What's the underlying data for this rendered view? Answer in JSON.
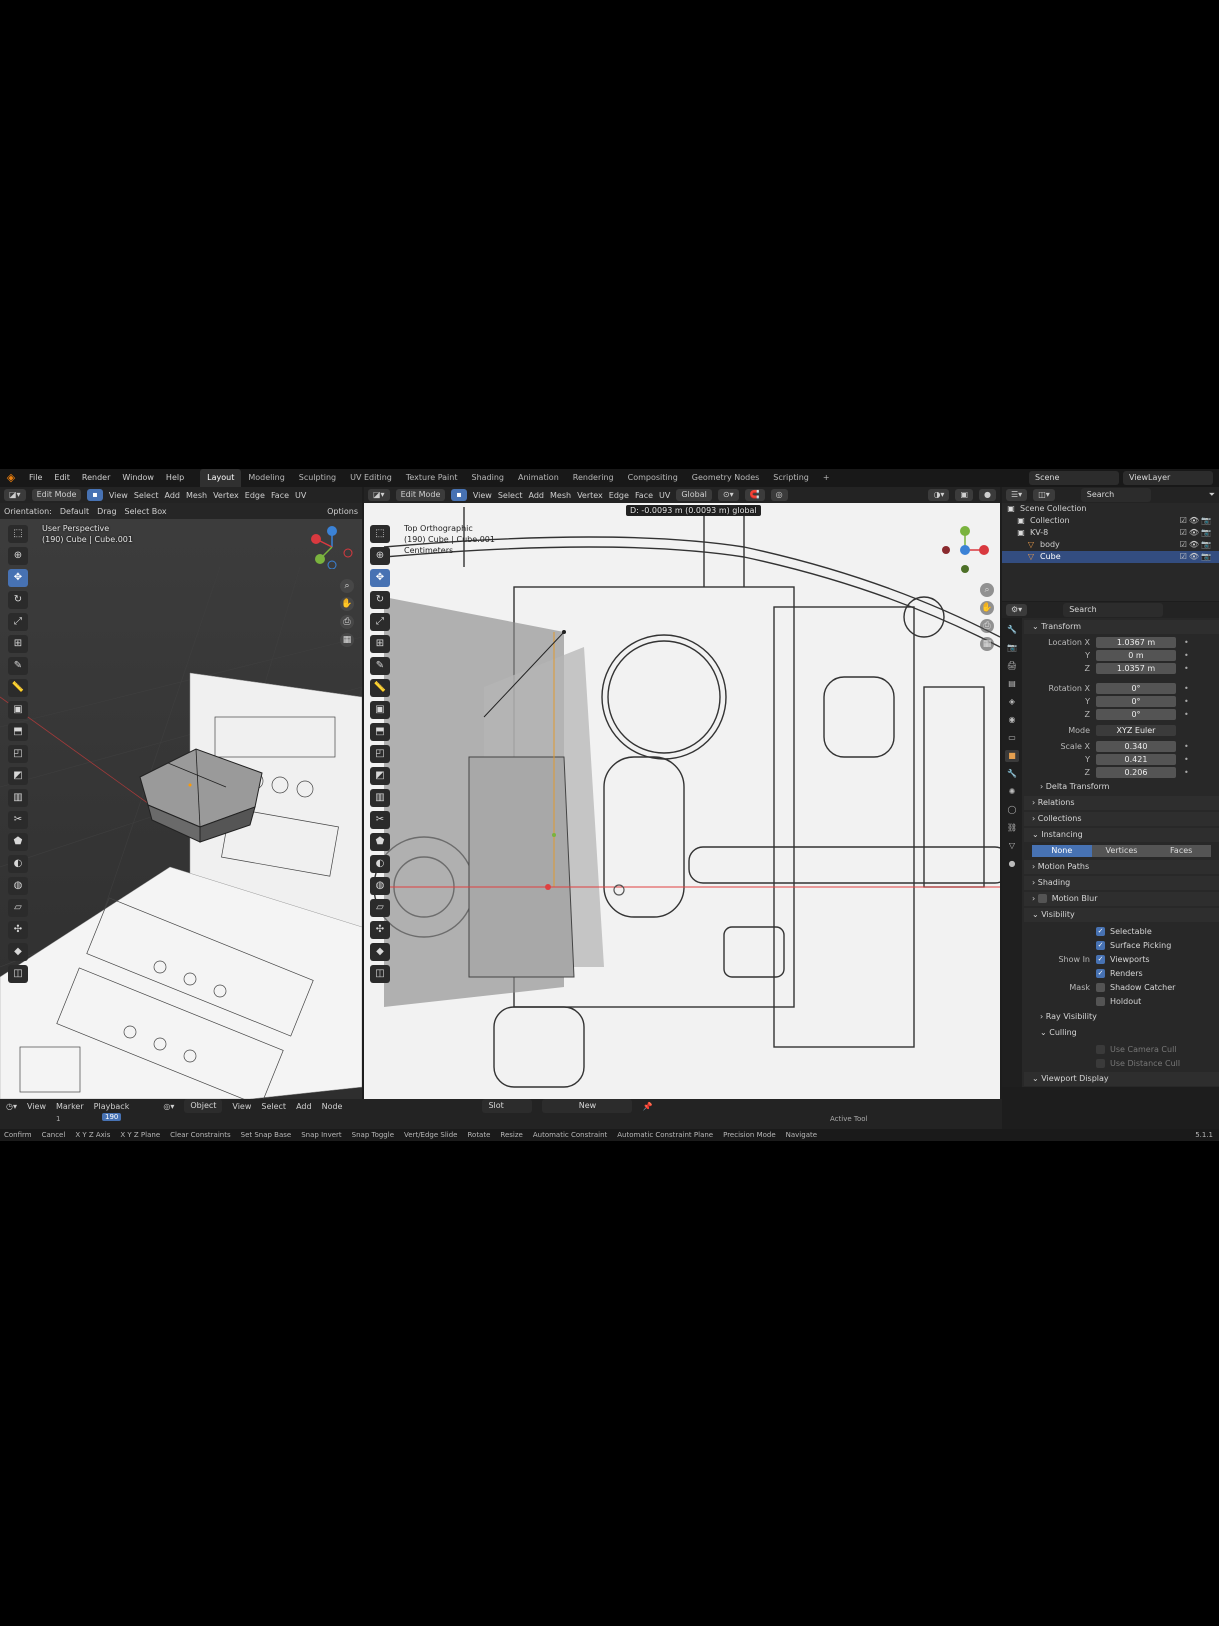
{
  "menubar": {
    "menus": [
      "File",
      "Edit",
      "Render",
      "Window",
      "Help"
    ],
    "workspaces": [
      "Layout",
      "Modeling",
      "Sculpting",
      "UV Editing",
      "Texture Paint",
      "Shading",
      "Animation",
      "Rendering",
      "Compositing",
      "Geometry Nodes",
      "Scripting",
      "+"
    ],
    "active_workspace": "Layout",
    "scene": "Scene",
    "view_layer": "ViewLayer"
  },
  "left_viewport": {
    "mode": "Edit Mode",
    "menus": [
      "View",
      "Select",
      "Add",
      "Mesh",
      "Vertex",
      "Edge",
      "Face",
      "UV"
    ],
    "orientation_label": "Orientation:",
    "orientation_value": "Default",
    "drag_label": "Drag",
    "select_box": "Select Box",
    "options": "Options",
    "view_name": "User Perspective",
    "object_info": "(190) Cube | Cube.001"
  },
  "right_viewport": {
    "mode": "Edit Mode",
    "menus": [
      "View",
      "Select",
      "Add",
      "Mesh",
      "Vertex",
      "Edge",
      "Face",
      "UV"
    ],
    "transform_orientation": "Global",
    "delta_readout": "D: -0.0093 m (0.0093 m) global",
    "view_name": "Top Orthographic",
    "object_info": "(190) Cube | Cube.001",
    "units": "Centimeters"
  },
  "outliner": {
    "search_placeholder": "Search",
    "rows": [
      {
        "label": "Scene Collection",
        "indent": 0,
        "selected": false,
        "icon": "collection-icon"
      },
      {
        "label": "Collection",
        "indent": 1,
        "selected": false,
        "icon": "collection-icon"
      },
      {
        "label": "KV-8",
        "indent": 1,
        "selected": false,
        "icon": "collection-icon"
      },
      {
        "label": "body",
        "indent": 2,
        "selected": false,
        "icon": "mesh-icon"
      },
      {
        "label": "Cube",
        "indent": 2,
        "selected": true,
        "icon": "mesh-icon"
      }
    ]
  },
  "properties": {
    "search_placeholder": "Search",
    "transform_header": "Transform",
    "location": {
      "label_x": "Location X",
      "x": "1.0367 m",
      "y": "0 m",
      "z": "1.0357 m"
    },
    "rotation": {
      "label_x": "Rotation X",
      "x": "0°",
      "y": "0°",
      "z": "0°"
    },
    "mode_label": "Mode",
    "mode_value": "XYZ Euler",
    "scale": {
      "label_x": "Scale X",
      "x": "0.340",
      "y": "0.421",
      "z": "0.206"
    },
    "axis_y": "Y",
    "axis_z": "Z",
    "delta_transform": "Delta Transform",
    "relations": "Relations",
    "collections": "Collections",
    "instancing": "Instancing",
    "instancing_options": [
      "None",
      "Vertices",
      "Faces"
    ],
    "instancing_active": "None",
    "motion_paths": "Motion Paths",
    "shading": "Shading",
    "motion_blur": "Motion Blur",
    "visibility": "Visibility",
    "selectable": "Selectable",
    "surface_picking": "Surface Picking",
    "show_in_label": "Show In",
    "viewports": "Viewports",
    "renders": "Renders",
    "mask_label": "Mask",
    "shadow_catcher": "Shadow Catcher",
    "holdout": "Holdout",
    "ray_visibility": "Ray Visibility",
    "culling": "Culling",
    "use_camera_cull": "Use Camera Cull",
    "use_distance_cull": "Use Distance Cull",
    "viewport_display": "Viewport Display"
  },
  "timeline": {
    "menus": [
      "View",
      "Marker",
      "Playback"
    ],
    "editor_type": "Object",
    "node_menus": [
      "View",
      "Select",
      "Add",
      "Node"
    ],
    "material_slot": "Slot",
    "new_button": "New",
    "current_frame": "190",
    "frame_start": "1",
    "active_tool_label": "Active Tool"
  },
  "statusbar": {
    "items": [
      "Confirm",
      "Cancel",
      "X Y Z Axis",
      "X Y Z Plane",
      "Clear Constraints",
      "Set Snap Base",
      "Snap Invert",
      "Snap Toggle",
      "Vert/Edge Slide",
      "Rotate",
      "Resize",
      "Automatic Constraint",
      "Automatic Constraint Plane",
      "Precision Mode",
      "Navigate"
    ],
    "version": "5.1.1"
  },
  "colors": {
    "accent": "#4772b3",
    "x_axis": "#d9393f",
    "y_axis": "#7ab33e",
    "z_axis": "#3b82d6",
    "blender_orange": "#e87d0d"
  }
}
